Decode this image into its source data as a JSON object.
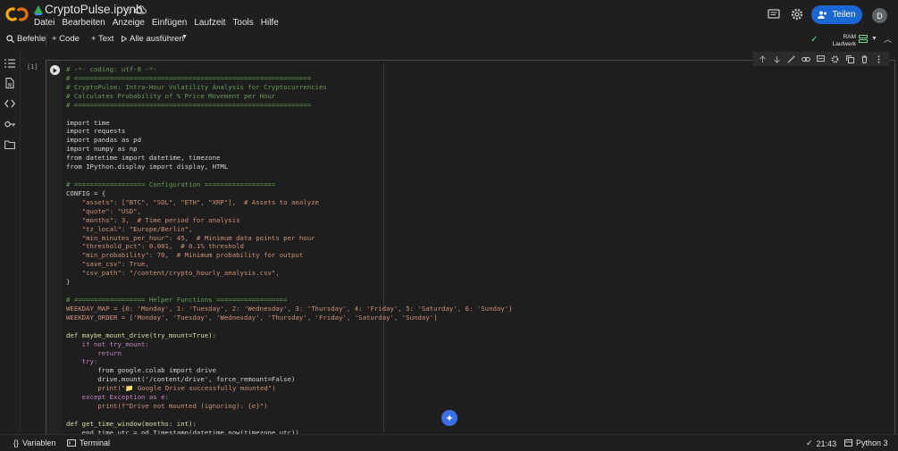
{
  "header": {
    "notebook_title": "CryptoPulse.ipynb",
    "menu": [
      "Datei",
      "Bearbeiten",
      "Anzeige",
      "Einfügen",
      "Laufzeit",
      "Tools",
      "Hilfe"
    ],
    "share_label": "Teilen",
    "avatar_letter": "D"
  },
  "toolbar": {
    "commands_label": "Befehle",
    "add_code_label": "+ Code",
    "add_text_label": "+ Text",
    "run_all_label": "Alle ausführen",
    "ram_label": "RAM",
    "disk_label": "Laufwerk"
  },
  "cell": {
    "execution_count": "[1]"
  },
  "status": {
    "variables_label": "Variablen",
    "terminal_label": "Terminal",
    "time": "21:43",
    "kernel": "Python 3"
  },
  "colors": {
    "accent": "#1967d2",
    "background": "#1f1f1f",
    "cell_background": "#1e1e1e",
    "ok_green": "#6dd58c"
  },
  "code_lines": [
    "# -*- coding: utf-8 -*-",
    "# ============================================================",
    "# CryptoPulse: Intra-Hour Volatility Analysis for Cryptocurrencies",
    "# Calculates Probability of % Price Movement per Hour",
    "# ============================================================",
    "",
    "import time",
    "import requests",
    "import pandas as pd",
    "import numpy as np",
    "from datetime import datetime, timezone",
    "from IPython.display import display, HTML",
    "",
    "# ================== Configuration ==================",
    "CONFIG = {",
    "    \"assets\": [\"BTC\", \"SOL\", \"ETH\", \"XRP\"],  # Assets to analyze",
    "    \"quote\": \"USD\",",
    "    \"months\": 3,  # Time period for analysis",
    "    \"tz_local\": \"Europe/Berlin\",",
    "    \"min_minutes_per_hour\": 45,  # Minimum data points per hour",
    "    \"threshold_pct\": 0.001,  # 0.1% threshold",
    "    \"min_probability\": 70,  # Minimum probability for output",
    "    \"save_csv\": True,",
    "    \"csv_path\": \"/content/crypto_hourly_analysis.csv\",",
    "}",
    "",
    "# ================== Helper Functions ==================",
    "WEEKDAY_MAP = {0: 'Monday', 1: 'Tuesday', 2: 'Wednesday', 3: 'Thursday', 4: 'Friday', 5: 'Saturday', 6: 'Sunday'}",
    "WEEKDAY_ORDER = ['Monday', 'Tuesday', 'Wednesday', 'Thursday', 'Friday', 'Saturday', 'Sunday']",
    "",
    "def maybe_mount_drive(try_mount=True):",
    "    if not try_mount:",
    "        return",
    "    try:",
    "        from google.colab import drive",
    "        drive.mount('/content/drive', force_remount=False)",
    "        print(\"📁 Google Drive successfully mounted\")",
    "    except Exception as e:",
    "        print(f\"Drive not mounted (ignoring): {e}\")",
    "",
    "def get_time_window(months: int):",
    "    end_time_utc = pd.Timestamp(datetime.now(timezone.utc))"
  ]
}
